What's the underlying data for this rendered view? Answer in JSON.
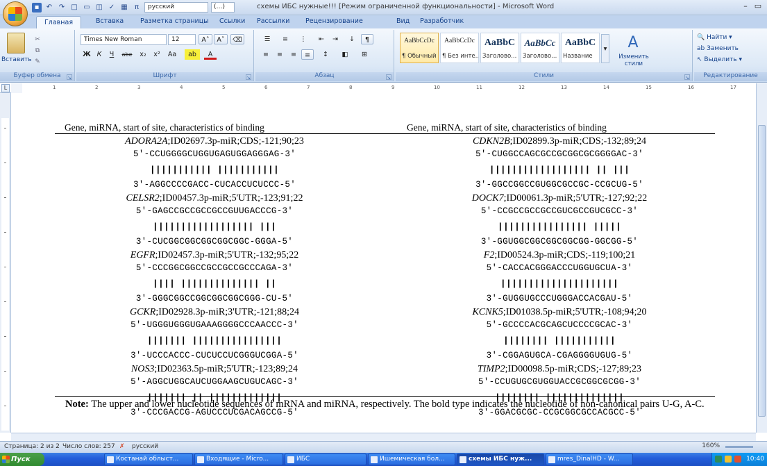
{
  "window": {
    "title": "схемы ИБС нужные!!! [Режим ограниченной функциональности] - Microsoft Word",
    "quick_access_font": "русский",
    "quick_access_style": "(…)"
  },
  "tabs": [
    "Главная",
    "Вставка",
    "Разметка страницы",
    "Ссылки",
    "Рассылки",
    "Рецензирование",
    "Вид",
    "Разработчик"
  ],
  "ribbon": {
    "clipboard": {
      "label": "Буфер обмена",
      "paste": "Вставить"
    },
    "font": {
      "label": "Шрифт",
      "family": "Times New Roman",
      "size": "12"
    },
    "paragraph": {
      "label": "Абзац"
    },
    "styles": {
      "label": "Стили",
      "items": [
        {
          "sample": "AaBbCcDc",
          "name": "¶ Обычный"
        },
        {
          "sample": "AaBbCcDc",
          "name": "¶ Без инте..."
        },
        {
          "sample": "AaBbC",
          "name": "Заголово..."
        },
        {
          "sample": "AaBbCc",
          "name": "Заголово..."
        },
        {
          "sample": "AaBbC",
          "name": "Название"
        }
      ],
      "change": "Изменить стили"
    },
    "editing": {
      "label": "Редактирование",
      "find": "Найти",
      "replace": "Заменить",
      "select": "Выделить"
    }
  },
  "ruler": {
    "numbers": [
      "1",
      "2",
      "3",
      "4",
      "5",
      "6",
      "7",
      "8",
      "9",
      "10",
      "11",
      "12",
      "13",
      "14",
      "15",
      "16",
      "17"
    ]
  },
  "document": {
    "header_left": "Gene, miRNA, start of site, characteristics  of binding",
    "header_right": "Gene, miRNA, start of site, characteristics  of binding",
    "left_entries": [
      {
        "gene": "ADORA2A",
        "info": ";ID02697.3p-miR;CDS;-121;90;23",
        "mrna": "5'-CCUGGGGCUGGUGAGUGGAGGGAG-3'",
        "bars": "||||||||||| |||||||||||",
        "mirna": "3'-AGGCCCCGACC-CUCACCUCUCCC-5'"
      },
      {
        "gene": "CELSR2",
        "info": ";ID00457.3p-miR;5'UTR;-123;91;22",
        "mrna": "5'-GAGCCGCCGCCGCCGUUGACCCG-3'",
        "bars": "|||||||||||||||||| |||",
        "mirna": "3'-CUCGGCGGCGGCGGCGGC-GGGA-5'"
      },
      {
        "gene": "EGFR",
        "info": ";ID02457.3p-miR;5'UTR;-132;95;22",
        "mrna": "5'-CCCGGCGGCCGCCGCCGCCCAGA-3'",
        "bars": "|||| |||||||||||||| ||",
        "mirna": "3'-GGGCGGCCGGCGGCGGCGGG-CU-5'"
      },
      {
        "gene": "GCKR",
        "info": ";ID02928.3p-miR;3'UTR;-121;88;24",
        "mrna": "5'-UGGGUGGGUGAAAGGGGCCCAACCC-3'",
        "bars": "||||||| ||||||||||||||||",
        "mirna": "3'-UCCCACCC-CUCUCCUCGGGUCGGA-5'"
      },
      {
        "gene": "NOS3",
        "info": ";ID02363.5p-miR;5'UTR;-123;89;24",
        "mrna": "5'-AGGCUGGCAUCUGGAAGCUGUCAGC-3'",
        "bars": "||||||| || |||||||||||||",
        "mirna": "3'-CCCGACCG-AGUCCCUCGACAGCCG-5'"
      }
    ],
    "right_entries": [
      {
        "gene": "CDKN2B",
        "info": ";ID02899.3p-miR;CDS;-132;89;24",
        "mrna": "5'-CUGGCCAGCGCCGCGGCGCGGGGAC-3'",
        "bars": "|||||||||||||||||| || |||",
        "mirna": "3'-GGCCGGCCGUGGCGCCGC-CCGCUG-5'"
      },
      {
        "gene": "DOCK7",
        "info": ";ID00061.3p-miR;5'UTR;-127;92;22",
        "mrna": "5'-CCGCCGCCGCCGUCGCCGUCGCC-3'",
        "bars": "|||||||||||||||| |||||",
        "mirna": "3'-GGUGGCGGCGGCGGCGG-GGCGG-5'"
      },
      {
        "gene": "F2",
        "info": ";ID00524.3p-miR;CDS;-119;100;21",
        "mrna": "5'-CACCACGGGACCCUGGUGCUA-3'",
        "bars": "|||||||||||||||||||||",
        "mirna": "3'-GUGGUGCCCUGGGACCACGAU-5'"
      },
      {
        "gene": "KCNK5",
        "info": ";ID01038.5p-miR;5'UTR;-108;94;20",
        "mrna": "5'-GCCCCACGCAGCUCCCCGCAC-3'",
        "bars": "|||||||| |||||||||||",
        "mirna": "3'-CGGAGUGCA-CGAGGGGUGUG-5'"
      },
      {
        "gene": "TIMP2",
        "info": ";ID00098.5p-miR;CDS;-127;89;23",
        "mrna": "5'-CCUGUGCGUGGUACCGCGGCGCGG-3'",
        "bars": "|||||||| ||||||||||||||",
        "mirna": "3'-GGACGCGC-CCGCGGCGCCACGCC-5'"
      }
    ],
    "note_label": "Note:",
    "note_text": " The upper and lower nucleotide sequences of mRNA and miRNA, respectively. The bold type indicates the nucleotide of non-canonical pairs U-G, A-C."
  },
  "statusbar": {
    "page": "Страница: 2 из 2",
    "words": "Число слов: 257",
    "language": "русский",
    "zoom": "160%"
  },
  "taskbar": {
    "start": "Пуск",
    "buttons": [
      "Костанай облыст...",
      "Входящие - Micro...",
      "ИБС",
      "Ишемическая бол...",
      "схемы ИБС нуж...",
      "mres_DinalHD - W..."
    ],
    "clock": "10:40"
  }
}
